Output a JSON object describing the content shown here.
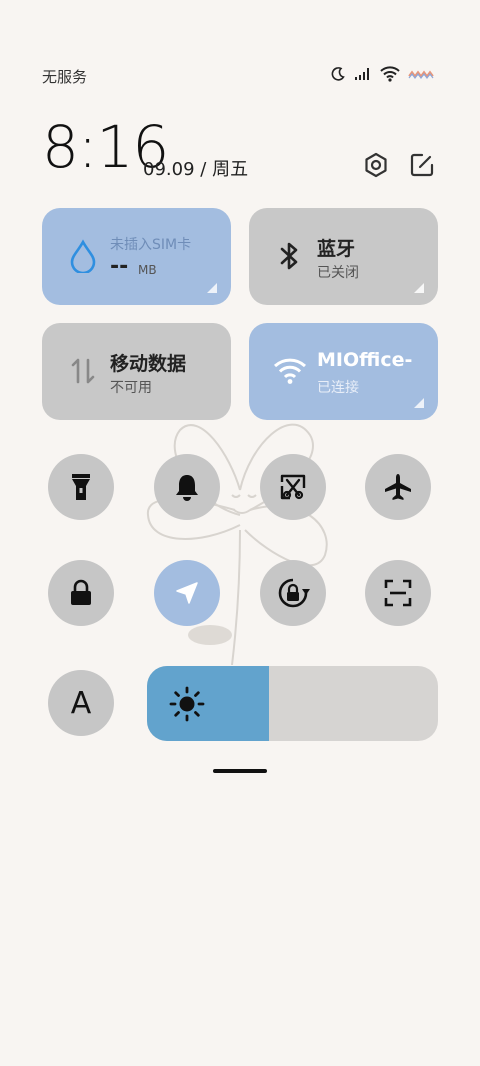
{
  "status_bar": {
    "carrier": "无服务",
    "icons": [
      "moon-icon",
      "signal-icon",
      "wifi-icon",
      "battery-icon"
    ]
  },
  "header": {
    "time": "8:16",
    "date": "09.09",
    "separator": "/",
    "weekday": "周五",
    "icons": [
      "settings-icon",
      "edit-icon"
    ]
  },
  "tiles": {
    "data_usage": {
      "title": "未插入SIM卡",
      "value": "--",
      "unit": "MB",
      "icon": "water-drop-icon",
      "active": true
    },
    "bluetooth": {
      "title": "蓝牙",
      "subtitle": "已关闭",
      "icon": "bluetooth-icon",
      "active": false
    },
    "mobile_data": {
      "title": "移动数据",
      "subtitle": "不可用",
      "icon": "data-arrows-icon",
      "active": false
    },
    "wifi": {
      "title": "MIOffice-",
      "subtitle": "已连接",
      "icon": "wifi-icon",
      "active": true
    }
  },
  "toggles_row1": [
    "flashlight-icon",
    "bell-icon",
    "screenshot-icon",
    "airplane-icon"
  ],
  "toggles_row2": [
    "lock-icon",
    "location-icon",
    "rotation-lock-icon",
    "scan-icon"
  ],
  "font_button": {
    "label": "A"
  },
  "brightness": {
    "level": 0.42,
    "icon": "sun-icon"
  },
  "colors": {
    "active_tile": "#a3bde0",
    "inactive_tile": "#c8c8c8",
    "brightness_fill": "#62a3cd",
    "background": "#f8f5f2"
  }
}
